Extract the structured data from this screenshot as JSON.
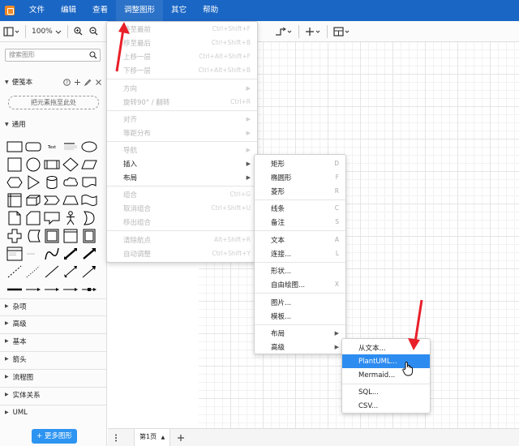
{
  "menubar": {
    "items": [
      "文件",
      "编辑",
      "查看",
      "调整图形",
      "其它",
      "帮助"
    ]
  },
  "toolbar": {
    "zoom": "100%"
  },
  "sidebar": {
    "search_placeholder": "搜索图形",
    "scratchpad_title": "便笺本",
    "scratchpad_drop": "把元素拖至此处",
    "general_title": "通用",
    "shape_text_label": "Text",
    "collapsed_sections": [
      "杂项",
      "高级",
      "基本",
      "箭头",
      "流程图",
      "实体关系",
      "UML"
    ],
    "more_shapes": "+ 更多图形"
  },
  "footer": {
    "page_tab": "第1页"
  },
  "arrange_menu": {
    "items": [
      {
        "label": "移至最前",
        "shortcut": "Ctrl+Shift+F"
      },
      {
        "label": "移至最后",
        "shortcut": "Ctrl+Shift+B"
      },
      {
        "label": "上移一层",
        "shortcut": "Ctrl+Alt+Shift+F"
      },
      {
        "label": "下移一层",
        "shortcut": "Ctrl+Alt+Shift+B"
      },
      {
        "label": "方向",
        "shortcut": ""
      },
      {
        "label": "旋转90° / 翻转",
        "shortcut": "Ctrl+R"
      },
      {
        "label": "对齐",
        "shortcut": ""
      },
      {
        "label": "等距分布",
        "shortcut": ""
      },
      {
        "label": "导航",
        "shortcut": ""
      },
      {
        "label": "插入",
        "shortcut": ""
      },
      {
        "label": "布局",
        "shortcut": ""
      },
      {
        "label": "组合",
        "shortcut": "Ctrl+G"
      },
      {
        "label": "取消组合",
        "shortcut": "Ctrl+Shift+U"
      },
      {
        "label": "移出组合",
        "shortcut": ""
      },
      {
        "label": "清除航点",
        "shortcut": "Alt+Shift+R"
      },
      {
        "label": "自动调整",
        "shortcut": "Ctrl+Shift+Y"
      }
    ]
  },
  "insert_menu": {
    "items": [
      {
        "label": "矩形",
        "shortcut": "D"
      },
      {
        "label": "椭圆形",
        "shortcut": "F"
      },
      {
        "label": "菱形",
        "shortcut": "R"
      },
      {
        "label": "线条",
        "shortcut": "C"
      },
      {
        "label": "备注",
        "shortcut": "S"
      },
      {
        "label": "文本",
        "shortcut": "A"
      },
      {
        "label": "连接...",
        "shortcut": "L"
      },
      {
        "label": "形状...",
        "shortcut": ""
      },
      {
        "label": "自由绘图...",
        "shortcut": "X"
      },
      {
        "label": "图片...",
        "shortcut": ""
      },
      {
        "label": "模板...",
        "shortcut": ""
      },
      {
        "label": "布局",
        "shortcut": ""
      },
      {
        "label": "高级",
        "shortcut": ""
      }
    ]
  },
  "advanced_menu": {
    "items": [
      {
        "label": "从文本..."
      },
      {
        "label": "PlantUML..."
      },
      {
        "label": "Mermaid..."
      },
      {
        "label": "SQL..."
      },
      {
        "label": "CSV..."
      }
    ]
  },
  "colors": {
    "menubar": "#1a66c4",
    "highlight": "#2d8cf0",
    "more_button": "#2d94f1",
    "annotation_arrow": "#e8202a"
  }
}
